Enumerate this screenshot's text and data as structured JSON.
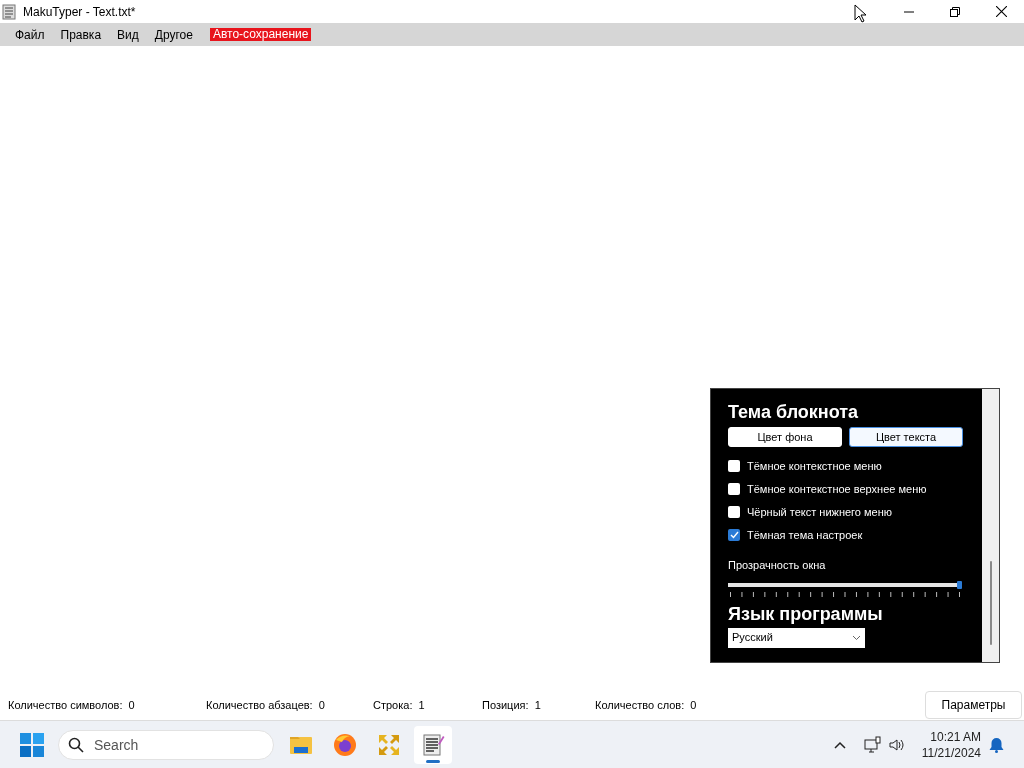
{
  "window": {
    "title": "MakuTyper - Text.txt*"
  },
  "menu": [
    {
      "label": "Файл",
      "kind": "plain"
    },
    {
      "label": "Правка",
      "kind": "plain"
    },
    {
      "label": "Вид",
      "kind": "plain"
    },
    {
      "label": "Другое",
      "kind": "plain"
    },
    {
      "label": "Авто-сохранение",
      "kind": "alert"
    }
  ],
  "settings_panel": {
    "theme_heading": "Тема блокнота",
    "buttons": [
      {
        "label": "Цвет фона",
        "selected": false
      },
      {
        "label": "Цвет текста",
        "selected": true
      }
    ],
    "options": [
      {
        "label": "Тёмное контекстное меню",
        "checked": false
      },
      {
        "label": "Тёмное контекстное верхнее меню",
        "checked": false
      },
      {
        "label": "Чёрный текст нижнего меню",
        "checked": false
      },
      {
        "label": "Тёмная тема настроек",
        "checked": true
      }
    ],
    "opacity": {
      "label": "Прозрачность окна",
      "level": 1
    },
    "language_heading": "Язык программы",
    "language": {
      "value": "Русский"
    }
  },
  "status_bar": [
    "Количество символов:  0",
    "Количество абзацев:  0",
    "Строка:  1",
    "Позиция:  1",
    "Количество слов:  0"
  ],
  "settings_button": "Параметры",
  "taskbar": {
    "search": {
      "placeholder": "Search"
    },
    "apps": [
      {
        "kind": "folder",
        "selected": false
      },
      {
        "kind": "browser",
        "selected": false
      },
      {
        "kind": "tool",
        "selected": false
      },
      {
        "kind": "notepad",
        "selected": true
      }
    ],
    "time": "10:21 AM",
    "date": "11/21/2024"
  }
}
